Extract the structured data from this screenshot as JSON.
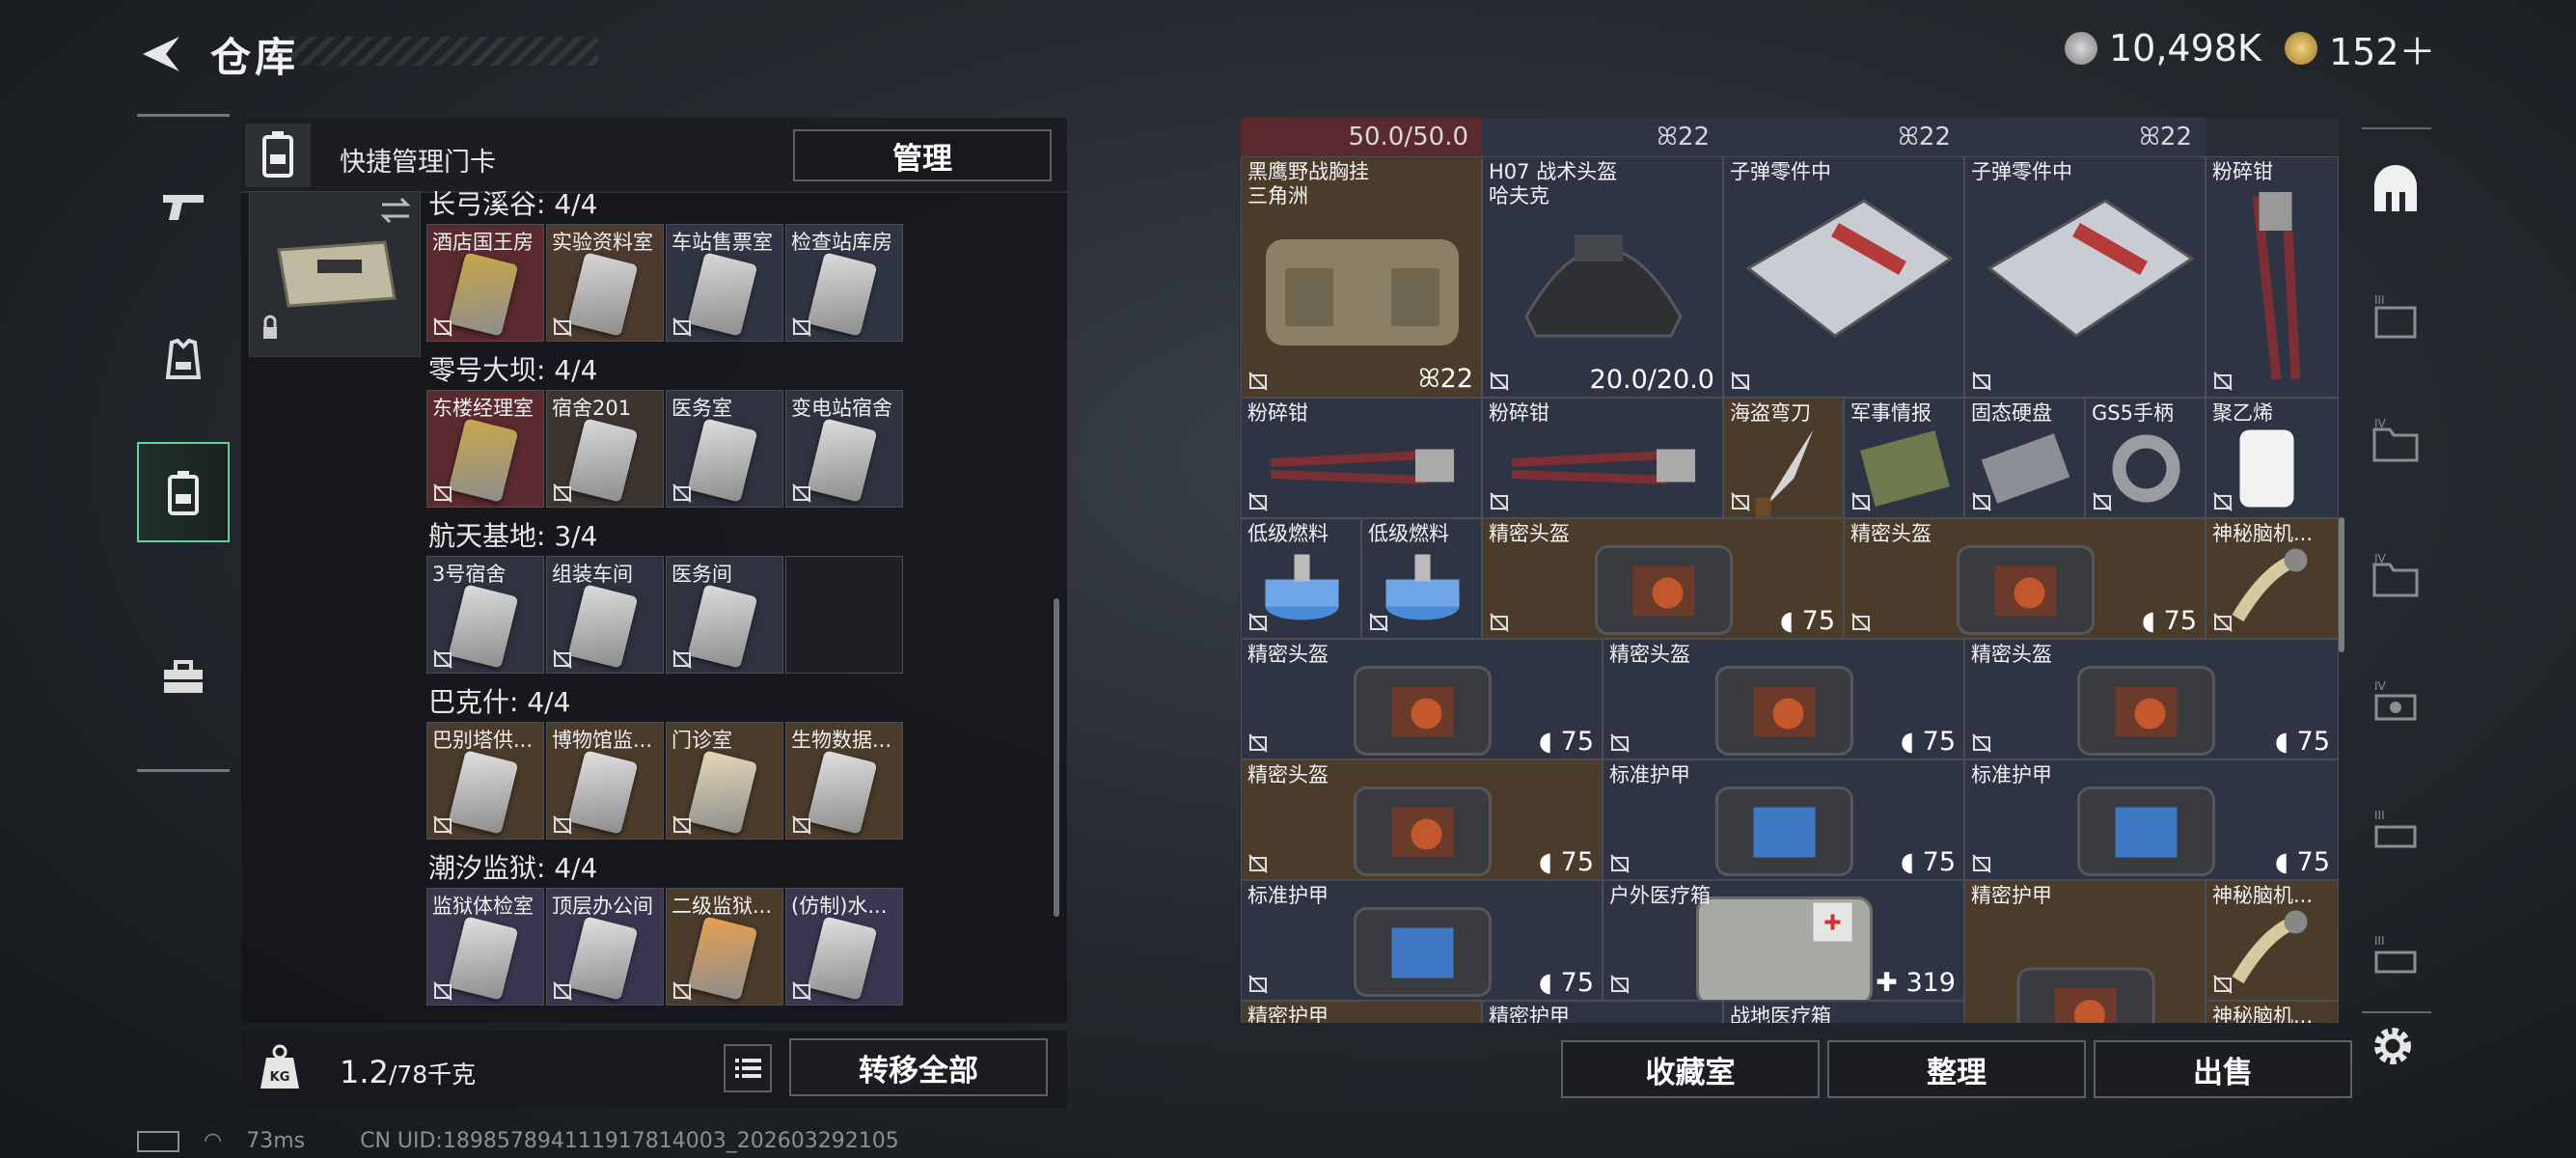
{
  "header": {
    "title": "仓库",
    "currency_silver": "10,498K",
    "currency_gold": "152＋"
  },
  "left_panel": {
    "quick_label": "快捷管理门卡",
    "manage_label": "管理",
    "weight_value": "1.2",
    "weight_max": "/78千克",
    "transfer_all_label": "转移全部",
    "maps": [
      {
        "title": "长弓溪谷: 4/4",
        "cards": [
          {
            "name": "酒店国王房",
            "bg": "#5a2a2f",
            "card": "#c9a64a"
          },
          {
            "name": "实验资料室",
            "bg": "#4d3a2f",
            "card": "#d7d7d7"
          },
          {
            "name": "车站售票室",
            "bg": "#2f3542",
            "card": "#d8d8d8"
          },
          {
            "name": "检查站库房",
            "bg": "#2f3542",
            "card": "#dcdcdc"
          }
        ]
      },
      {
        "title": "零号大坝: 4/4",
        "cards": [
          {
            "name": "东楼经理室",
            "bg": "#5a2a2f",
            "card": "#c8a84c"
          },
          {
            "name": "宿舍201",
            "bg": "#3d3530",
            "card": "#d9d9d9"
          },
          {
            "name": "医务室",
            "bg": "#2f3340",
            "card": "#dedede"
          },
          {
            "name": "变电站宿舍",
            "bg": "#2f3340",
            "card": "#dedede"
          }
        ]
      },
      {
        "title": "航天基地: 3/4",
        "cards": [
          {
            "name": "3号宿舍",
            "bg": "#2f3340",
            "card": "#dcdcdc"
          },
          {
            "name": "组装车间",
            "bg": "#2f3340",
            "card": "#dcdcdc"
          },
          {
            "name": "医务间",
            "bg": "#2f3340",
            "card": "#dcdcdc"
          },
          {
            "name": "",
            "bg": "#1e2024",
            "card": ""
          }
        ]
      },
      {
        "title": "巴克什: 4/4",
        "cards": [
          {
            "name": "巴别塔供...",
            "bg": "#4a3b2b",
            "card": "#e0e0e0"
          },
          {
            "name": "博物馆监...",
            "bg": "#4a3b2b",
            "card": "#e0e0e0"
          },
          {
            "name": "门诊室",
            "bg": "#4a3b2b",
            "card": "#e3d9b8"
          },
          {
            "name": "生物数据...",
            "bg": "#4a3b2b",
            "card": "#e0e0e0"
          }
        ]
      },
      {
        "title": "潮汐监狱: 4/4",
        "cards": [
          {
            "name": "监狱体检室",
            "bg": "#3b3550",
            "card": "#e0e0e0"
          },
          {
            "name": "顶层办公间",
            "bg": "#3b3550",
            "card": "#e0e0e0"
          },
          {
            "name": "二级监狱...",
            "bg": "#4a3b2b",
            "card": "#e8a050"
          },
          {
            "name": "(仿制)水...",
            "bg": "#3b3550",
            "card": "#e0e0e0"
          }
        ]
      }
    ]
  },
  "stash": {
    "header": {
      "durability": "50.0/50.0",
      "qty1": "22",
      "qty2": "22",
      "qty3": "22"
    },
    "items": {
      "chest_rig": {
        "name": "黑鹰野战胸挂\n三角洲",
        "value": "22"
      },
      "helmet": {
        "name": "H07 战术头盔\n哈夫克",
        "value": "20.0/20.0"
      },
      "ammo_parts1": {
        "name": "子弹零件中"
      },
      "ammo_parts2": {
        "name": "子弹零件中"
      },
      "crusher_tall": {
        "name": "粉碎钳"
      },
      "crusher1": {
        "name": "粉碎钳"
      },
      "crusher2": {
        "name": "粉碎钳"
      },
      "pirate_knife": {
        "name": "海盗弯刀"
      },
      "military_intel": {
        "name": "军事情报"
      },
      "ssd": {
        "name": "固态硬盘"
      },
      "gs5": {
        "name": "GS5手柄"
      },
      "polyethylene": {
        "name": "聚乙烯"
      },
      "fuel1": {
        "name": "低级燃料"
      },
      "fuel2": {
        "name": "低级燃料"
      },
      "helmet_bag_a": {
        "name": "精密头盔",
        "value": "75"
      },
      "helmet_bag_b": {
        "name": "精密头盔",
        "value": "75"
      },
      "mystery1": {
        "name": "神秘脑机..."
      },
      "helmet_bag_c": {
        "name": "精密头盔",
        "value": "75"
      },
      "helmet_bag_d": {
        "name": "精密头盔",
        "value": "75"
      },
      "helmet_bag_e": {
        "name": "精密头盔",
        "value": "75"
      },
      "helmet_bag_f": {
        "name": "精密头盔",
        "value": "75"
      },
      "armor_a": {
        "name": "标准护甲",
        "value": "75"
      },
      "armor_b": {
        "name": "标准护甲",
        "value": "75"
      },
      "armor_c": {
        "name": "标准护甲",
        "value": "75"
      },
      "medkit": {
        "name": "户外医疗箱",
        "value": "319"
      },
      "precise_armor": {
        "name": "精密护甲"
      },
      "mystery2": {
        "name": "神秘脑机..."
      },
      "precise_armor2": {
        "name": "精密护甲"
      },
      "precise_armor3": {
        "name": "精密护甲"
      },
      "field_medkit": {
        "name": "战地医疗箱"
      },
      "mystery3": {
        "name": "神秘脑机..."
      }
    },
    "buttons": {
      "collection": "收藏室",
      "sort": "整理",
      "sell": "出售"
    }
  },
  "status_bar": {
    "ping": "73ms",
    "uid": "CN UID:189857894111917814003_202603292105"
  },
  "colors": {
    "accent_green": "#5fd39b",
    "brown_cell": "#4a3b2b",
    "blue_cell": "#2f3445",
    "red_cell": "#5a2a2f"
  }
}
